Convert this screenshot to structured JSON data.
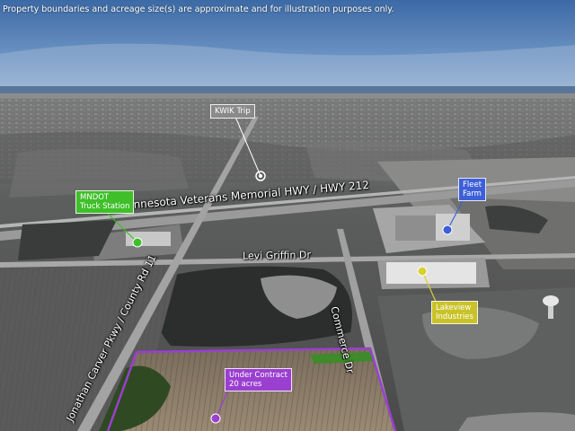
{
  "disclaimer": "Property boundaries and acreage size(s) are approximate and for illustration purposes only.",
  "roads": {
    "highway": "Minnesota Veterans Memorial HWY / HWY 212",
    "levi_griffin": "Levi Griffin Dr",
    "commerce": "Commerce Dr",
    "jonathan_carver": "Jonathan Carver Pkwy / County Rd 11"
  },
  "callouts": {
    "kwik_trip": {
      "line1": "KWIK Trip"
    },
    "mndot": {
      "line1": "MNDOT",
      "line2": "Truck Station"
    },
    "fleet_farm": {
      "line1": "Fleet",
      "line2": "Farm"
    },
    "lakeview": {
      "line1": "Lakeview",
      "line2": "Industries"
    },
    "under_contract": {
      "line1": "Under Contract",
      "line2": "20 acres"
    }
  },
  "colors": {
    "mndot": "#3fbf2a",
    "fleet_farm": "#3f5fd8",
    "lakeview": "#d8d230",
    "under_contract": "#9a3fd0",
    "kwik_trip": "#8a8a8a"
  }
}
